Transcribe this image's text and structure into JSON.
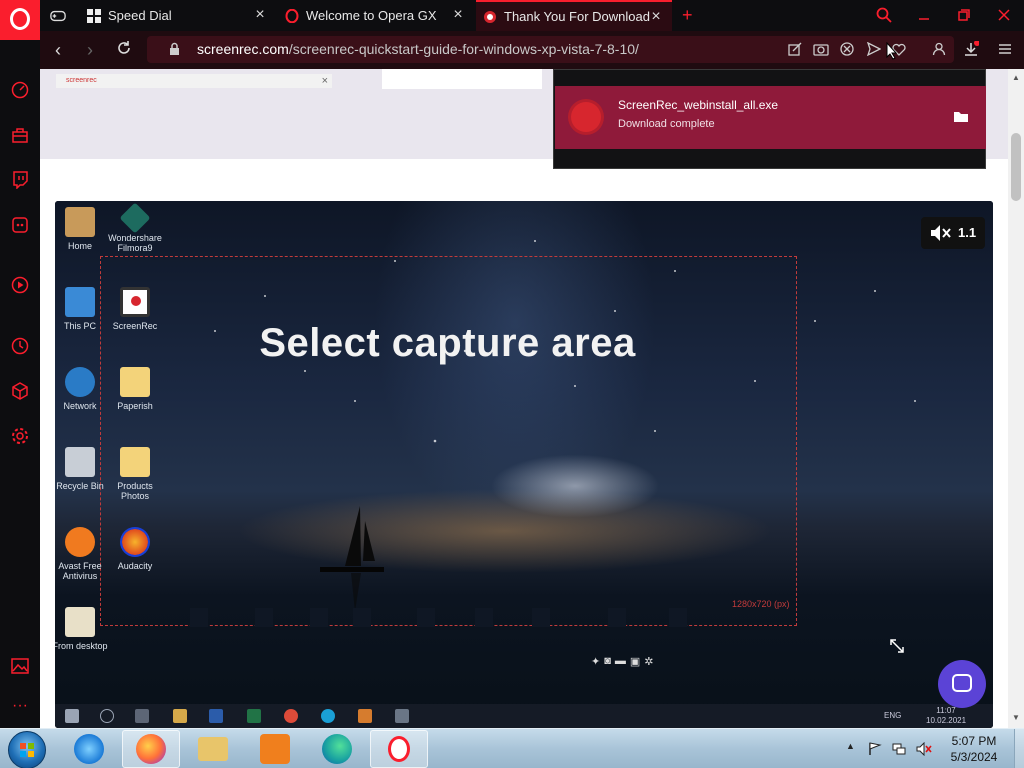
{
  "browser": {
    "tabs": [
      {
        "title": "Speed Dial",
        "icon": "speed-dial-icon"
      },
      {
        "title": "Welcome to Opera GX",
        "icon": "opera-icon"
      },
      {
        "title": "Thank You For Downloadin",
        "icon": "screenrec-icon"
      }
    ],
    "url": {
      "domain": "screenrec.com",
      "path": "/screenrec-quickstart-guide-for-windows-xp-vista-7-8-10/"
    },
    "accent_color": "#fa1e2d"
  },
  "download": {
    "file_name": "ScreenRec_webinstall_all.exe",
    "status": "Download complete"
  },
  "page": {
    "ad_brand": "screenrec",
    "video": {
      "overlay_title": "Select capture area",
      "capture_size": "1280x720 (px)",
      "speed": "1.1",
      "desktop_icons": [
        {
          "label": "Home"
        },
        {
          "label": "Wondershare Filmora9"
        },
        {
          "label": "This PC"
        },
        {
          "label": "ScreenRec"
        },
        {
          "label": "Paperish"
        },
        {
          "label": "Network"
        },
        {
          "label": "Recycle Bin"
        },
        {
          "label": "Products Photos"
        },
        {
          "label": "Avast Free Antivirus"
        },
        {
          "label": "Audacity"
        },
        {
          "label": "From desktop"
        }
      ],
      "tray_lang": "ENG",
      "tray_time": "11:07",
      "tray_date": "10.02.2021"
    }
  },
  "taskbar": {
    "time": "5:07 PM",
    "date": "5/3/2024"
  }
}
